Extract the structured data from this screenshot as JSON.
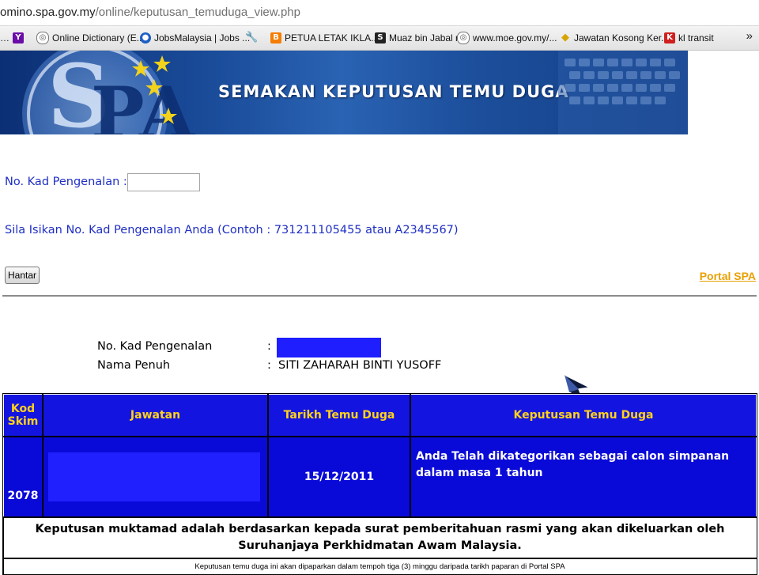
{
  "browser": {
    "url_host": "omino.spa.gov.my",
    "url_path": "/online/keputusan_temuduga_view.php",
    "bookmarks": [
      {
        "label": "",
        "icon": "yahoo-icon"
      },
      {
        "label": "Online Dictionary (E...",
        "icon": "globe-icon"
      },
      {
        "label": "JobsMalaysia | Jobs ...",
        "icon": "jobsmalaysia-icon"
      },
      {
        "label": "",
        "icon": "wrench-icon"
      },
      {
        "label": "PETUA LETAK IKLA...",
        "icon": "blogger-icon"
      },
      {
        "label": "Muaz bin Jabal r",
        "icon": "scribd-icon"
      },
      {
        "label": "www.moe.gov.my/...",
        "icon": "globe-icon"
      },
      {
        "label": "Jawatan Kosong Ker...",
        "icon": "tag-icon"
      },
      {
        "label": "kl transit",
        "icon": "k-icon"
      }
    ],
    "overflow_glyph": "»"
  },
  "banner": {
    "title": "SEMAKAN KEPUTUSAN TEMU DUGA",
    "logo_text": "SPA"
  },
  "form": {
    "ic_label": "No. Kad Pengenalan :",
    "ic_value": "",
    "hint": "Sila Isikan No. Kad Pengenalan Anda (Contoh : 731211105455 atau A2345567)",
    "submit_label": "Hantar",
    "portal_link": "Portal SPA"
  },
  "applicant": {
    "ic_label": "No. Kad Pengenalan",
    "name_label": "Nama Penuh",
    "colon": ":",
    "name_value": "SITI ZAHARAH BINTI YUSOFF"
  },
  "results": {
    "headers": {
      "kod": "Kod Skim",
      "jawatan": "Jawatan",
      "tarikh": "Tarikh Temu Duga",
      "keputusan": "Keputusan Temu Duga"
    },
    "row": {
      "kod": "2078",
      "tarikh": "15/12/2011",
      "keputusan": "Anda Telah dikategorikan sebagai calon simpanan dalam masa 1 tahun"
    },
    "note": "Keputusan muktamad adalah berdasarkan kepada surat pemberitahuan rasmi yang akan dikeluarkan oleh Suruhanjaya Perkhidmatan Awam Malaysia.",
    "footer": "Keputusan temu duga ini akan dipaparkan dalam tempoh tiga (3) minggu daripada tarikh paparan di Portal SPA"
  },
  "colors": {
    "table_header_bg": "#1414e0",
    "table_header_text": "#ffd21a",
    "table_row_bg": "#0a0ad8",
    "form_text": "#1f2fc3",
    "portal_link": "#e8a000",
    "redaction": "#1e1eff"
  }
}
